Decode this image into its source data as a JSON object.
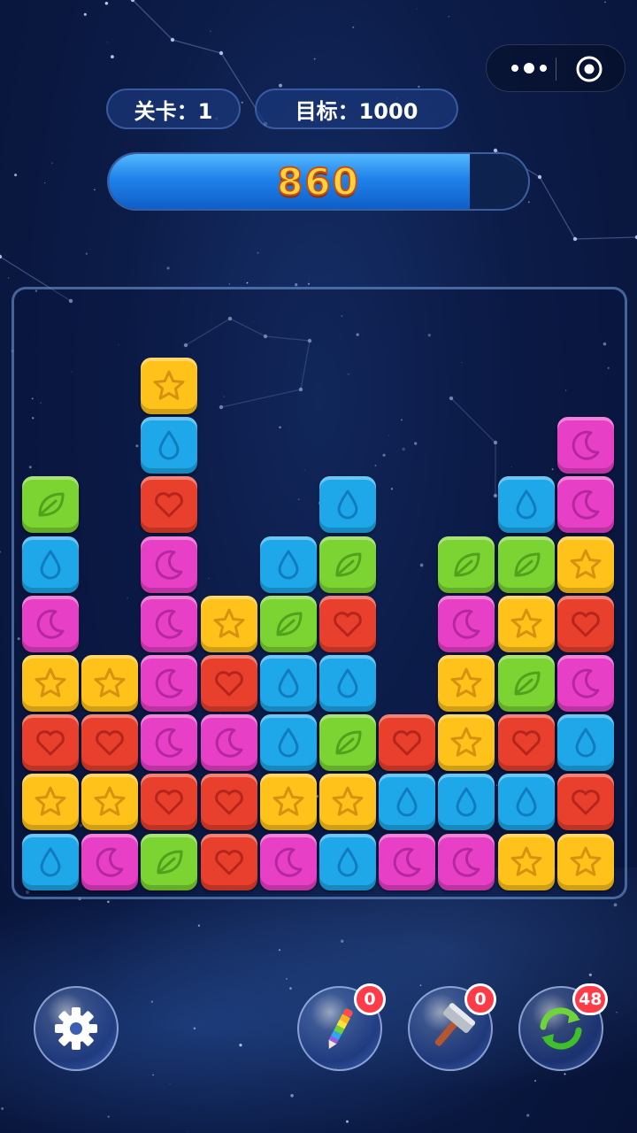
{
  "header": {
    "level_label": "关卡：1",
    "target_label": "目标：1000"
  },
  "score": {
    "value": "860",
    "progress": 0.86
  },
  "menu": {
    "more_icon": "more-dots-icon",
    "close_icon": "target-circle-icon"
  },
  "colors": {
    "star": "#ffc21a",
    "drop": "#1ea8ea",
    "moon": "#e83fc7",
    "heart": "#e8402d",
    "leaf": "#7bd431",
    "accent_bar": "#2b8ff0",
    "badge": "#ff3b4a"
  },
  "board": {
    "columns": 10,
    "rows": 9,
    "tiles": [
      [
        "",
        "",
        "star",
        "",
        "",
        "",
        "",
        "",
        "",
        ""
      ],
      [
        "",
        "",
        "drop",
        "",
        "",
        "",
        "",
        "",
        "",
        "moon"
      ],
      [
        "leaf",
        "",
        "heart",
        "",
        "",
        "drop",
        "",
        "",
        "drop",
        "moon"
      ],
      [
        "drop",
        "",
        "moon",
        "",
        "drop",
        "leaf",
        "",
        "leaf",
        "leaf",
        "star"
      ],
      [
        "moon",
        "",
        "moon",
        "star",
        "leaf",
        "heart",
        "",
        "moon",
        "star",
        "heart"
      ],
      [
        "star",
        "star",
        "moon",
        "heart",
        "drop",
        "drop",
        "",
        "star",
        "leaf",
        "moon"
      ],
      [
        "heart",
        "heart",
        "moon",
        "moon",
        "drop",
        "leaf",
        "heart",
        "star",
        "heart",
        "drop"
      ],
      [
        "star",
        "star",
        "heart",
        "heart",
        "star",
        "star",
        "drop",
        "drop",
        "drop",
        "heart"
      ],
      [
        "drop",
        "moon",
        "leaf",
        "heart",
        "moon",
        "drop",
        "moon",
        "moon",
        "star",
        "star"
      ]
    ]
  },
  "tools": {
    "settings": {
      "icon": "gear-icon"
    },
    "paint": {
      "icon": "paint-brush-icon",
      "count": "0"
    },
    "hammer": {
      "icon": "hammer-icon",
      "count": "0"
    },
    "refresh": {
      "icon": "refresh-icon",
      "count": "48"
    }
  }
}
